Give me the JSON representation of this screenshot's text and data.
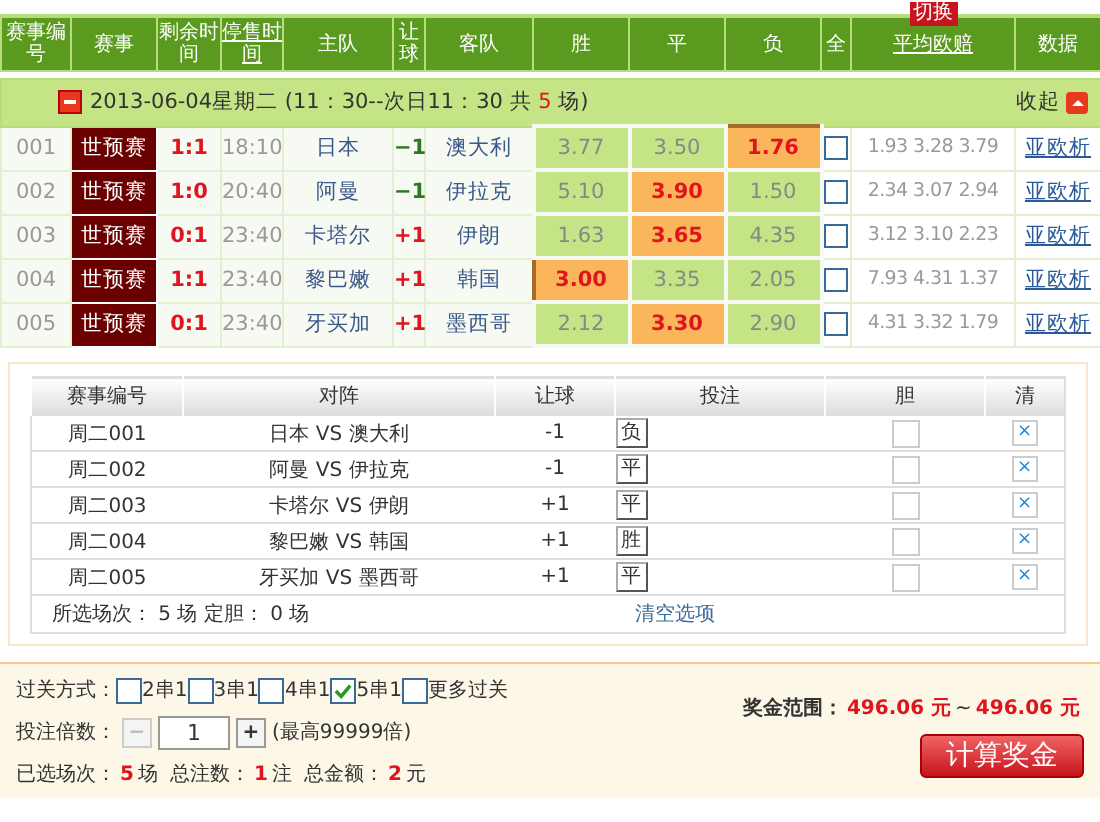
{
  "header": {
    "columns": [
      "赛事编号",
      "赛事",
      "剩余时间",
      "停售时间",
      "主队",
      "让球",
      "客队",
      "胜",
      "平",
      "负",
      "全",
      "平均欧赔",
      "数据"
    ],
    "switch_tag": "切换"
  },
  "group": {
    "expanded": true,
    "date": "2013-06-04星期二 (11：30--次日11：30 共 ",
    "count": "5",
    "suffix": " 场)",
    "collapse": "收起"
  },
  "matches": [
    {
      "id": "001",
      "league": "世预赛",
      "score": "1:1",
      "stop_time": "18:10",
      "home": "日本",
      "handicap": {
        "text": "−1",
        "color": "#2a7a1e"
      },
      "away": "澳大利",
      "odds": [
        {
          "value": "3.77",
          "selected": false
        },
        {
          "value": "3.50",
          "selected": false
        },
        {
          "value": "1.76",
          "selected": true
        }
      ],
      "all": false,
      "avg": "1.93 3.28 3.79",
      "links": [
        "亚",
        "欧",
        "析"
      ]
    },
    {
      "id": "002",
      "league": "世预赛",
      "score": "1:0",
      "stop_time": "20:40",
      "home": "阿曼",
      "handicap": {
        "text": "−1",
        "color": "#2a7a1e"
      },
      "away": "伊拉克",
      "odds": [
        {
          "value": "5.10",
          "selected": false
        },
        {
          "value": "3.90",
          "selected": true
        },
        {
          "value": "1.50",
          "selected": false
        }
      ],
      "all": false,
      "avg": "2.34 3.07 2.94",
      "links": [
        "亚",
        "欧",
        "析"
      ]
    },
    {
      "id": "003",
      "league": "世预赛",
      "score": "0:1",
      "stop_time": "23:40",
      "home": "卡塔尔",
      "handicap": {
        "text": "+1",
        "color": "#e0141e"
      },
      "away": "伊朗",
      "odds": [
        {
          "value": "1.63",
          "selected": false
        },
        {
          "value": "3.65",
          "selected": true
        },
        {
          "value": "4.35",
          "selected": false
        }
      ],
      "all": false,
      "avg": "3.12 3.10 2.23",
      "links": [
        "亚",
        "欧",
        "析"
      ]
    },
    {
      "id": "004",
      "league": "世预赛",
      "score": "1:1",
      "stop_time": "23:40",
      "home": "黎巴嫩",
      "handicap": {
        "text": "+1",
        "color": "#e0141e"
      },
      "away": "韩国",
      "odds": [
        {
          "value": "3.00",
          "selected": true
        },
        {
          "value": "3.35",
          "selected": false
        },
        {
          "value": "2.05",
          "selected": false
        }
      ],
      "all": false,
      "avg": "7.93 4.31 1.37",
      "links": [
        "亚",
        "欧",
        "析"
      ]
    },
    {
      "id": "005",
      "league": "世预赛",
      "score": "0:1",
      "stop_time": "23:40",
      "home": "牙买加",
      "handicap": {
        "text": "+1",
        "color": "#e0141e"
      },
      "away": "墨西哥",
      "odds": [
        {
          "value": "2.12",
          "selected": false
        },
        {
          "value": "3.30",
          "selected": true
        },
        {
          "value": "2.90",
          "selected": false
        }
      ],
      "all": false,
      "avg": "4.31 3.32 1.79",
      "links": [
        "亚",
        "欧",
        "析"
      ]
    }
  ],
  "bets": {
    "columns": [
      "赛事编号",
      "对阵",
      "让球",
      "投注",
      "胆",
      "清"
    ],
    "rows": [
      {
        "id": "周二001",
        "match": "日本 VS 澳大利",
        "handicap": "-1",
        "pick": "负",
        "banker": false,
        "clear": "×"
      },
      {
        "id": "周二002",
        "match": "阿曼 VS 伊拉克",
        "handicap": "-1",
        "pick": "平",
        "banker": false,
        "clear": "×"
      },
      {
        "id": "周二003",
        "match": "卡塔尔 VS 伊朗",
        "handicap": "+1",
        "pick": "平",
        "banker": false,
        "clear": "×"
      },
      {
        "id": "周二004",
        "match": "黎巴嫩 VS 韩国",
        "handicap": "+1",
        "pick": "胜",
        "banker": false,
        "clear": "×"
      },
      {
        "id": "周二005",
        "match": "牙买加 VS 墨西哥",
        "handicap": "+1",
        "pick": "平",
        "banker": false,
        "clear": "×"
      }
    ],
    "summary": "所选场次： 5 场 定胆： 0 场",
    "clear_all": "清空选项"
  },
  "pass": {
    "label": "过关方式：",
    "options": [
      {
        "label": "2串1",
        "checked": false
      },
      {
        "label": "3串1",
        "checked": false
      },
      {
        "label": "4串1",
        "checked": false
      },
      {
        "label": "5串1",
        "checked": true
      },
      {
        "label": "更多过关",
        "checked": false
      }
    ]
  },
  "multiple": {
    "label": "投注倍数：",
    "minus": "−",
    "value": "1",
    "plus": "+",
    "hint": "(最高99999倍)"
  },
  "totals": [
    {
      "label": "已选场次：",
      "value": "5",
      "unit": "场"
    },
    {
      "label": "总注数：",
      "value": "1",
      "unit": "注"
    },
    {
      "label": "总金额：",
      "value": "2",
      "unit": "元"
    }
  ],
  "prize": {
    "label": "奖金范围：",
    "min": "496.06 元",
    "sep": "~",
    "max": "496.06 元"
  },
  "calculate": "计算奖金"
}
